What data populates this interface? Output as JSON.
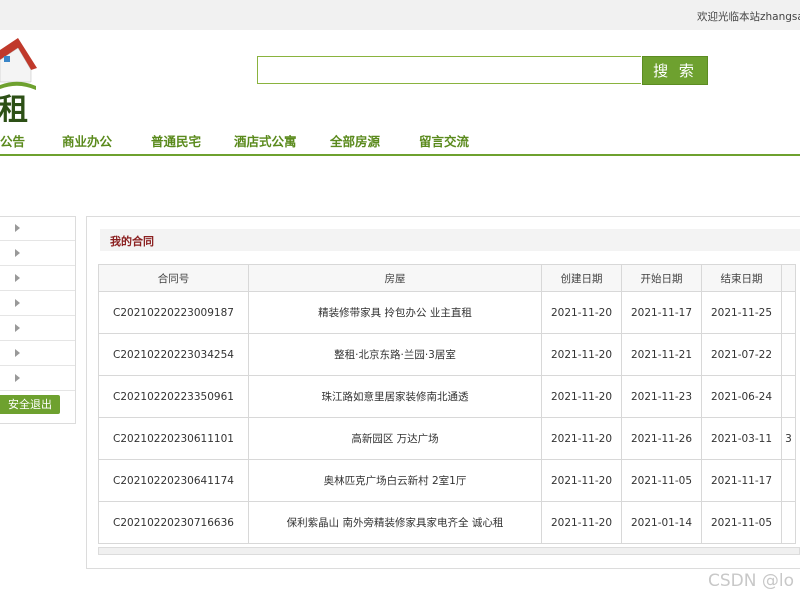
{
  "header": {
    "welcome_text": "欢迎光临本站zhangsa",
    "logo_char": "租"
  },
  "search": {
    "placeholder": "",
    "button_label": "搜 索"
  },
  "nav": {
    "items": [
      {
        "label": "公告"
      },
      {
        "label": "商业办公"
      },
      {
        "label": "普通民宅"
      },
      {
        "label": "酒店式公寓"
      },
      {
        "label": "全部房源"
      },
      {
        "label": "留言交流"
      }
    ]
  },
  "sidebar": {
    "logout_label": "安全退出"
  },
  "main": {
    "title": "我的合同",
    "columns": [
      "合同号",
      "房屋",
      "创建日期",
      "开始日期",
      "结束日期"
    ],
    "rows": [
      {
        "id": "C20210220223009187",
        "house": "精装修带家具 拎包办公 业主直租",
        "created": "2021-11-20",
        "start": "2021-11-17",
        "end": "2021-11-25",
        "extra": ""
      },
      {
        "id": "C20210220223034254",
        "house": "整租·北京东路·兰园·3居室",
        "created": "2021-11-20",
        "start": "2021-11-21",
        "end": "2021-07-22",
        "extra": ""
      },
      {
        "id": "C20210220223350961",
        "house": "珠江路如意里居家装修南北通透",
        "created": "2021-11-20",
        "start": "2021-11-23",
        "end": "2021-06-24",
        "extra": ""
      },
      {
        "id": "C20210220230611101",
        "house": "高新园区 万达广场",
        "created": "2021-11-20",
        "start": "2021-11-26",
        "end": "2021-03-11",
        "extra": "3"
      },
      {
        "id": "C20210220230641174",
        "house": "奥林匹克广场白云新村 2室1厅",
        "created": "2021-11-20",
        "start": "2021-11-05",
        "end": "2021-11-17",
        "extra": ""
      },
      {
        "id": "C20210220230716636",
        "house": "保利紫晶山 南外旁精装修家具家电齐全 诚心租",
        "created": "2021-11-20",
        "start": "2021-01-14",
        "end": "2021-11-05",
        "extra": ""
      }
    ]
  },
  "watermark": "CSDN @lo"
}
